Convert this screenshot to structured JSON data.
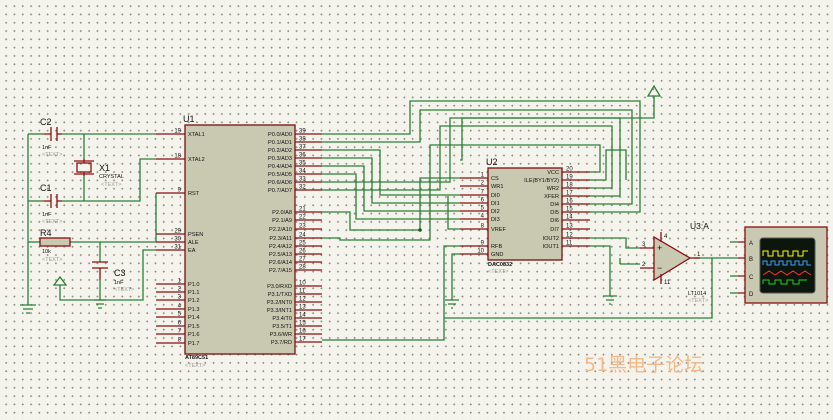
{
  "components": {
    "u1": {
      "ref": "U1",
      "part": "AT89C51",
      "text": "<TEXT>"
    },
    "u2": {
      "ref": "U2",
      "part": "DAC0832",
      "text": "<TEXT>"
    },
    "u3": {
      "ref": "U3:A",
      "part": "LT1014",
      "text": "<TEXT>"
    },
    "x1": {
      "ref": "X1",
      "part": "CRYSTAL",
      "text": "<TEXT>"
    },
    "c1": {
      "ref": "C1",
      "value": "1nF",
      "text": "<TEXT>"
    },
    "c2": {
      "ref": "C2",
      "value": "1nF",
      "text": "<TEXT>"
    },
    "c3": {
      "ref": "C3",
      "value": "1nF",
      "text": "<TEXT>"
    },
    "r4": {
      "ref": "R4",
      "value": "10k",
      "text": "<TEXT>"
    }
  },
  "u1_left_pins": [
    {
      "name": "XTAL1",
      "num": "19"
    },
    {
      "name": "XTAL2",
      "num": "18"
    },
    {
      "name": "RST",
      "num": "9"
    },
    {
      "name": "PSEN",
      "num": "29"
    },
    {
      "name": "ALE",
      "num": "30"
    },
    {
      "name": "EA",
      "num": "31"
    },
    {
      "name": "P1.0",
      "num": "1"
    },
    {
      "name": "P1.1",
      "num": "2"
    },
    {
      "name": "P1.2",
      "num": "3"
    },
    {
      "name": "P1.3",
      "num": "4"
    },
    {
      "name": "P1.4",
      "num": "5"
    },
    {
      "name": "P1.5",
      "num": "6"
    },
    {
      "name": "P1.6",
      "num": "7"
    },
    {
      "name": "P1.7",
      "num": "8"
    }
  ],
  "u1_right_pins": [
    {
      "name": "P0.0/AD0",
      "num": "39"
    },
    {
      "name": "P0.1/AD1",
      "num": "38"
    },
    {
      "name": "P0.2/AD2",
      "num": "37"
    },
    {
      "name": "P0.3/AD3",
      "num": "36"
    },
    {
      "name": "P0.4/AD4",
      "num": "35"
    },
    {
      "name": "P0.5/AD5",
      "num": "34"
    },
    {
      "name": "P0.6/AD6",
      "num": "33"
    },
    {
      "name": "P0.7/AD7",
      "num": "32"
    },
    {
      "name": "P2.0/A8",
      "num": "21"
    },
    {
      "name": "P2.1/A9",
      "num": "22"
    },
    {
      "name": "P2.2/A10",
      "num": "23"
    },
    {
      "name": "P2.3/A11",
      "num": "24"
    },
    {
      "name": "P2.4/A12",
      "num": "25"
    },
    {
      "name": "P2.5/A13",
      "num": "26"
    },
    {
      "name": "P2.6/A14",
      "num": "27"
    },
    {
      "name": "P2.7/A15",
      "num": "28"
    },
    {
      "name": "P3.0/RXD",
      "num": "10"
    },
    {
      "name": "P3.1/TXD",
      "num": "11"
    },
    {
      "name": "P3.2/INT0",
      "num": "12"
    },
    {
      "name": "P3.3/INT1",
      "num": "13"
    },
    {
      "name": "P3.4/T0",
      "num": "14"
    },
    {
      "name": "P3.5/T1",
      "num": "15"
    },
    {
      "name": "P3.6/WR",
      "num": "16"
    },
    {
      "name": "P3.7/RD",
      "num": "17"
    }
  ],
  "u2_left_pins": [
    {
      "name": "CS",
      "num": "1"
    },
    {
      "name": "WR1",
      "num": "2"
    },
    {
      "name": "DI0",
      "num": "7"
    },
    {
      "name": "DI1",
      "num": "6"
    },
    {
      "name": "DI2",
      "num": "5"
    },
    {
      "name": "DI3",
      "num": "4"
    },
    {
      "name": "VREF",
      "num": "8"
    },
    {
      "name": "RFB",
      "num": "9"
    },
    {
      "name": "GND",
      "num": "10"
    }
  ],
  "u2_right_pins": [
    {
      "name": "VCC",
      "num": "20"
    },
    {
      "name": "ILE(BY1/BY2)",
      "num": "19"
    },
    {
      "name": "WR2",
      "num": "18"
    },
    {
      "name": "XFER",
      "num": "17"
    },
    {
      "name": "DI4",
      "num": "16"
    },
    {
      "name": "DI5",
      "num": "15"
    },
    {
      "name": "DI6",
      "num": "14"
    },
    {
      "name": "DI7",
      "num": "13"
    },
    {
      "name": "IOUT2",
      "num": "12"
    },
    {
      "name": "IOUT1",
      "num": "11"
    }
  ],
  "u3_pins": {
    "in_plus": "3",
    "in_minus": "2",
    "out": "1",
    "v_plus": "4",
    "v_minus": "11"
  },
  "scope": {
    "channels": [
      "A",
      "B",
      "C",
      "D"
    ],
    "trace_colors": [
      "#ffff00",
      "#3aa0ff",
      "#ff3030",
      "#20d020"
    ]
  },
  "watermark": "51黑电子论坛",
  "colors": {
    "wire": "#2b7f38",
    "pin": "#8a0f0f",
    "chip_fill": "#c9c9b2",
    "watermark": "#f2b98a",
    "scope_screen": "#0c160c"
  }
}
